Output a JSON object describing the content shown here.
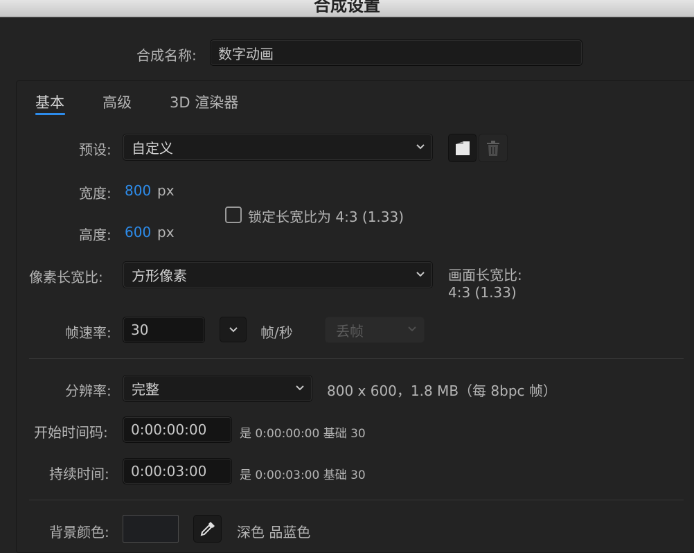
{
  "window": {
    "title": "合成设置"
  },
  "comp_name": {
    "label": "合成名称:",
    "value": "数字动画"
  },
  "tabs": [
    {
      "label": "基本",
      "active": true
    },
    {
      "label": "高级",
      "active": false
    },
    {
      "label": "3D 渲染器",
      "active": false
    }
  ],
  "preset": {
    "label": "预设:",
    "value": "自定义",
    "icons": [
      "save-preset-icon",
      "trash-icon"
    ]
  },
  "width": {
    "label": "宽度:",
    "value": "800",
    "unit": "px"
  },
  "height": {
    "label": "高度:",
    "value": "600",
    "unit": "px"
  },
  "lock_aspect": {
    "label": "锁定长宽比为 4:3 (1.33)",
    "checked": false
  },
  "pixel_aspect": {
    "label": "像素长宽比:",
    "value": "方形像素"
  },
  "frame_aspect": {
    "label": "画面长宽比:",
    "value": "4:3 (1.33)"
  },
  "frame_rate": {
    "label": "帧速率:",
    "value": "30",
    "unit": "帧/秒",
    "drop_frame": "丢帧"
  },
  "resolution": {
    "label": "分辨率:",
    "value": "完整",
    "info": "800 x 600，1.8 MB（每 8bpc 帧）"
  },
  "start_timecode": {
    "label": "开始时间码:",
    "value": "0:00:00:00",
    "info": "是 0:00:00:00  基础 30"
  },
  "duration": {
    "label": "持续时间:",
    "value": "0:00:03:00",
    "info": "是 0:00:03:00  基础 30"
  },
  "background": {
    "label": "背景颜色:",
    "color_name": "深色 品蓝色",
    "swatch": "#1e1f22",
    "icons": [
      "eyedropper-icon"
    ]
  },
  "colors": {
    "accent": "#2d8ceb",
    "background": "#232323",
    "text": "#b4b4b4"
  }
}
